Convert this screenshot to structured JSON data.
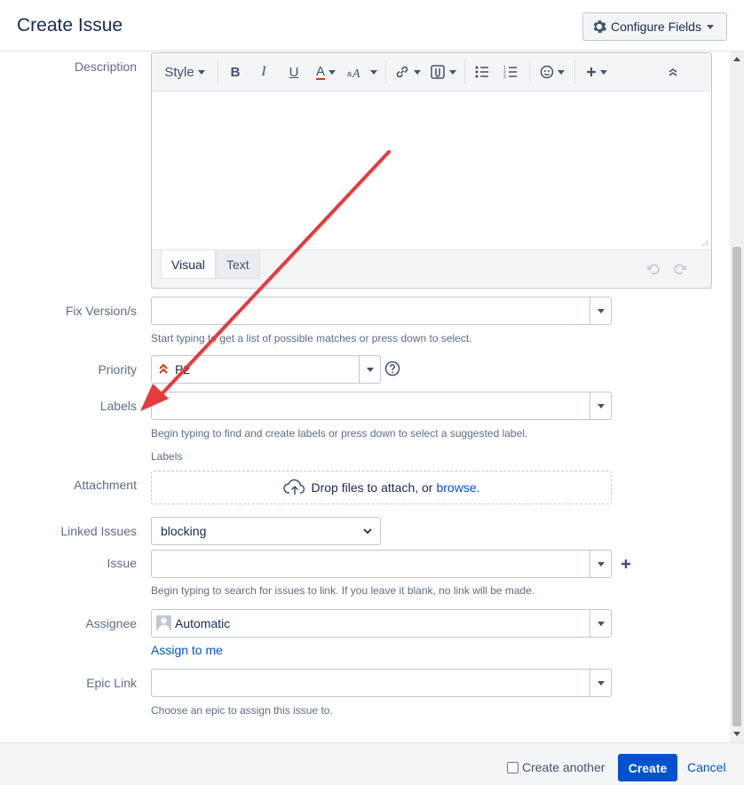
{
  "header": {
    "title": "Create Issue",
    "configure_label": "Configure Fields"
  },
  "description": {
    "label": "Description",
    "toolbar": {
      "style_label": "Style",
      "bold": "B",
      "italic": "I",
      "underline": "U",
      "text_color": "A",
      "icons": [
        "more-formatting-icon",
        "link-icon",
        "attachment-icon",
        "bullet-list-icon",
        "numbered-list-icon",
        "emoticon-icon",
        "insert-more-icon",
        "collapse-icon"
      ]
    },
    "tabs": {
      "visual": "Visual",
      "text": "Text"
    }
  },
  "fix_version": {
    "label": "Fix Version/s",
    "hint": "Start typing to get a list of possible matches or press down to select."
  },
  "priority": {
    "label": "Priority",
    "value": "P2",
    "color": "#de350b"
  },
  "labels": {
    "label": "Labels",
    "hint": "Begin typing to find and create labels or press down to select a suggested label.",
    "sub_label": "Labels"
  },
  "attachment": {
    "label": "Attachment",
    "drop_text": "Drop files to attach, or",
    "browse": "browse."
  },
  "linked_issues": {
    "label": "Linked Issues",
    "value": "blocking"
  },
  "issue": {
    "label": "Issue",
    "hint": "Begin typing to search for issues to link. If you leave it blank, no link will be made."
  },
  "assignee": {
    "label": "Assignee",
    "value": "Automatic",
    "assign_to_me": "Assign to me"
  },
  "epic_link": {
    "label": "Epic Link",
    "hint": "Choose an epic to assign this issue to."
  },
  "footer": {
    "create_another": "Create another",
    "create": "Create",
    "cancel": "Cancel"
  },
  "colors": {
    "primary": "#0052cc",
    "annotation_arrow": "#e8393c"
  }
}
